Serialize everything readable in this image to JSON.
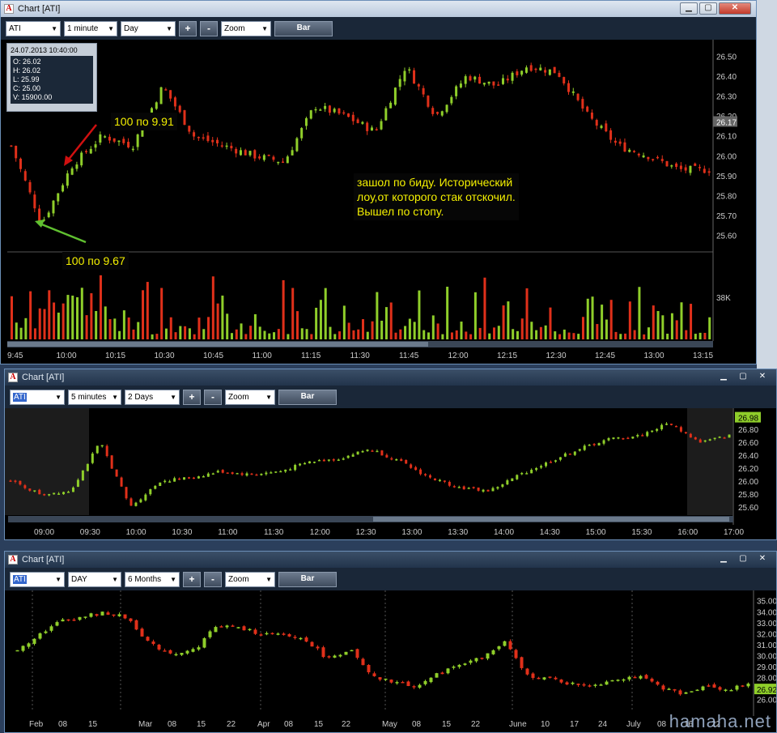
{
  "windows": [
    {
      "title": "Chart [ATI]",
      "symbol": "ATI",
      "interval": "1 minute",
      "range": "Day",
      "zoom": "Zoom",
      "bar": "Bar",
      "plus": "+",
      "minus": "-",
      "ohlc": {
        "date": "24.07.2013 10:40:00",
        "o": "O: 26.02",
        "h": "H: 26.02",
        "l": "L: 25.99",
        "c": "C: 25.00",
        "v": "V: 15900.00"
      },
      "annotations": [
        "100 по 9.91",
        "100 по 9.67",
        "зашол по биду. Исторический",
        "лоу,от которого стак отскочил.",
        "Вышел по стопу."
      ],
      "price_labels": [
        "26.50",
        "26.40",
        "26.30",
        "26.20",
        "26.17",
        "26.10",
        "26.00",
        "25.90",
        "25.80",
        "25.70",
        "25.60"
      ],
      "volume_label": "38K",
      "time_labels": [
        "9:45",
        "10:00",
        "10:15",
        "10:30",
        "10:45",
        "11:00",
        "11:15",
        "11:30",
        "11:45",
        "12:00",
        "12:15",
        "12:30",
        "12:45",
        "13:00",
        "13:15"
      ]
    },
    {
      "title": "Chart [ATI]",
      "symbol": "ATI",
      "interval": "5 minutes",
      "range": "2 Days",
      "zoom": "Zoom",
      "bar": "Bar",
      "plus": "+",
      "minus": "-",
      "price_labels": [
        "26.98",
        "26.80",
        "26.60",
        "26.40",
        "26.20",
        "26.00",
        "25.80",
        "25.60"
      ],
      "time_labels": [
        "09:00",
        "09:30",
        "10:00",
        "10:30",
        "11:00",
        "11:30",
        "12:00",
        "12:30",
        "13:00",
        "13:30",
        "14:00",
        "14:30",
        "15:00",
        "15:30",
        "16:00",
        "17:00"
      ]
    },
    {
      "title": "Chart [ATI]",
      "symbol": "ATI",
      "interval": "DAY",
      "range": "6 Months",
      "zoom": "Zoom",
      "bar": "Bar",
      "plus": "+",
      "minus": "-",
      "price_labels": [
        "35.00",
        "34.00",
        "33.00",
        "32.00",
        "31.00",
        "30.00",
        "29.00",
        "28.00",
        "26.92",
        "26.00"
      ],
      "time_labels": [
        "Feb",
        "08",
        "15",
        "Mar",
        "08",
        "15",
        "22",
        "Apr",
        "08",
        "15",
        "22",
        "May",
        "08",
        "15",
        "22",
        "June",
        "10",
        "17",
        "24",
        "July",
        "08",
        "16",
        "22"
      ]
    }
  ],
  "watermark": "hamaha.net",
  "colors": {
    "up": "#8fce2a",
    "down": "#e0301a",
    "bg": "#000000"
  }
}
